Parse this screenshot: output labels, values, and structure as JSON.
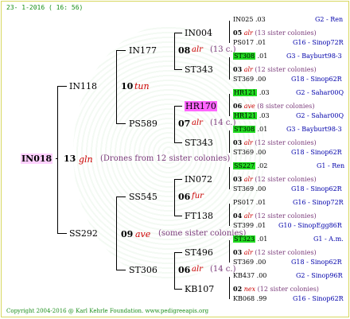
{
  "header": "23-  1-2016 ( 16: 56)",
  "footer": "Copyright 2004-2016 @ Karl Kehrle Foundation.   www.pedigreeapis.org",
  "root": {
    "name": "IN018",
    "num": "13",
    "star": "gln",
    "desc": "(Drones from 12 sister colonies)"
  },
  "gen1": [
    {
      "name": "IN118",
      "num": "10",
      "star": "tun",
      "desc": ""
    },
    {
      "name": "SS292",
      "num": "09",
      "star": "ave",
      "desc": "(some sister colonies)"
    }
  ],
  "gen2": [
    {
      "name": "IN177",
      "num": "08",
      "star": "alr",
      "desc": "(13 c.)"
    },
    {
      "name": "PS589",
      "num": "07",
      "star": "alr",
      "desc": "(14 c.)"
    },
    {
      "name": "SS545",
      "num": "06",
      "star": "fur",
      "desc": ""
    },
    {
      "name": "ST306",
      "num": "06",
      "star": "alr",
      "desc": "(14 c.)"
    }
  ],
  "gen3": [
    {
      "name": "IN004",
      "num": "05",
      "star": "alr",
      "desc": "(13 sister colonies)"
    },
    {
      "name": "ST343",
      "num": "03",
      "star": "alr",
      "desc": "(12 sister colonies)"
    },
    {
      "name": "HR170",
      "num": "06",
      "star": "ave",
      "desc": "(8 sister colonies)"
    },
    {
      "name": "ST343",
      "num": "03",
      "star": "alr",
      "desc": "(12 sister colonies)"
    },
    {
      "name": "IN072",
      "num": "03",
      "star": "alr",
      "desc": "(12 sister colonies)"
    },
    {
      "name": "FT138",
      "num": "04",
      "star": "alr",
      "desc": "(12 sister colonies)"
    },
    {
      "name": "ST496",
      "num": "03",
      "star": "alr",
      "desc": "(12 sister colonies)"
    },
    {
      "name": "KB107",
      "num": "02",
      "star": "nex",
      "desc": "(12 sister colonies)"
    }
  ],
  "gen4": [
    {
      "name": "IN025",
      "yr": ".03",
      "code": "G2 - Ren"
    },
    {
      "name": "PS017",
      "yr": ".01",
      "code": "G16 - Sinop72R"
    },
    {
      "name": "ST308",
      "yr": ".01",
      "code": "G3 - Bayburt98-3"
    },
    {
      "name": "ST369",
      "yr": ".00",
      "code": "G18 - Sinop62R"
    },
    {
      "name": "HR121",
      "yr": ".03",
      "code": "G2 - Sahar00Q"
    },
    {
      "name": "HR121",
      "yr": ".03",
      "code": "G2 - Sahar00Q"
    },
    {
      "name": "ST308",
      "yr": ".01",
      "code": "G3 - Bayburt98-3"
    },
    {
      "name": "ST369",
      "yr": ".00",
      "code": "G18 - Sinop62R"
    },
    {
      "name": "SS227",
      "yr": ".02",
      "code": "G1 - Ren"
    },
    {
      "name": "ST369",
      "yr": ".00",
      "code": "G18 - Sinop62R"
    },
    {
      "name": "PS017",
      "yr": ".01",
      "code": "G16 - Sinop72R"
    },
    {
      "name": "ST399",
      "yr": ".01",
      "code": "G10 - SinopEgg86R"
    },
    {
      "name": "ST323",
      "yr": ".01",
      "code": "G1 - A.m."
    },
    {
      "name": "ST369",
      "yr": ".00",
      "code": "G18 - Sinop62R"
    },
    {
      "name": "KB437",
      "yr": ".00",
      "code": "G2 - Sinop96R"
    },
    {
      "name": "KB068",
      "yr": ".99",
      "code": "G16 - Sinop62R"
    }
  ]
}
